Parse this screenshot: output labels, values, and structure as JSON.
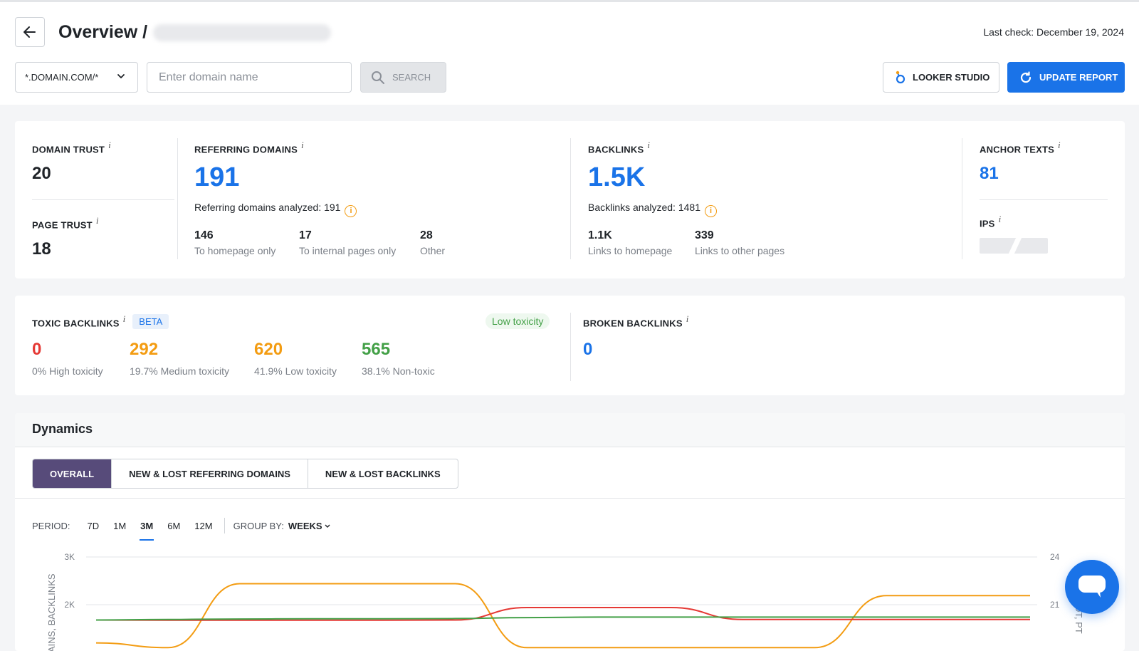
{
  "header": {
    "title": "Overview /",
    "last_check": "Last check: December 19, 2024",
    "scope_value": "*.DOMAIN.COM/*",
    "domain_placeholder": "Enter domain name",
    "search_label": "SEARCH",
    "looker_label": "LOOKER STUDIO",
    "update_label": "UPDATE REPORT"
  },
  "metrics": {
    "domain_trust": {
      "label": "DOMAIN TRUST",
      "value": "20"
    },
    "page_trust": {
      "label": "PAGE TRUST",
      "value": "18"
    },
    "referring_domains": {
      "label": "REFERRING DOMAINS",
      "value": "191",
      "analyzed": "Referring domains analyzed: 191",
      "breakdown": [
        {
          "value": "146",
          "caption": "To homepage only"
        },
        {
          "value": "17",
          "caption": "To internal pages only"
        },
        {
          "value": "28",
          "caption": "Other"
        }
      ]
    },
    "backlinks": {
      "label": "BACKLINKS",
      "value": "1.5K",
      "analyzed": "Backlinks analyzed: 1481",
      "breakdown": [
        {
          "value": "1.1K",
          "caption": "Links to homepage"
        },
        {
          "value": "339",
          "caption": "Links to other pages"
        }
      ]
    },
    "anchor_texts": {
      "label": "ANCHOR TEXTS",
      "value": "81"
    },
    "ips": {
      "label": "IPS"
    }
  },
  "toxic": {
    "label": "TOXIC BACKLINKS",
    "beta": "BETA",
    "badge": "Low toxicity",
    "items": [
      {
        "value": "0",
        "caption": "0% High toxicity",
        "color": "#e53935"
      },
      {
        "value": "292",
        "caption": "19.7% Medium toxicity",
        "color": "#f39c12"
      },
      {
        "value": "620",
        "caption": "41.9% Low toxicity",
        "color": "#f39c12"
      },
      {
        "value": "565",
        "caption": "38.1% Non-toxic",
        "color": "#43a047"
      }
    ]
  },
  "broken": {
    "label": "BROKEN BACKLINKS",
    "value": "0"
  },
  "dynamics": {
    "title": "Dynamics",
    "tabs": [
      "OVERALL",
      "NEW & LOST REFERRING DOMAINS",
      "NEW & LOST BACKLINKS"
    ],
    "period_label": "PERIOD:",
    "periods": [
      "7D",
      "1M",
      "3M",
      "6M",
      "12M"
    ],
    "active_period": "3M",
    "group_label": "GROUP BY:",
    "group_value": "WEEKS"
  },
  "chart_data": {
    "type": "line",
    "y_left": {
      "label": "AINS, BACKLINKS",
      "ticks": [
        "3K",
        "2K"
      ],
      "range": [
        1000,
        3000
      ]
    },
    "y_right": {
      "label": "DT, PT",
      "ticks": [
        "24",
        "21"
      ]
    },
    "x_index": [
      0,
      1,
      2,
      3,
      4,
      5,
      6,
      7,
      8,
      9,
      10,
      11,
      12,
      13
    ],
    "series": [
      {
        "color": "#f39c12",
        "values": [
          1200,
          1100,
          2440,
          2440,
          2440,
          2440,
          1100,
          1100,
          1100,
          1100,
          1100,
          2190,
          2190,
          2190
        ]
      },
      {
        "color": "#e53935",
        "values": [
          1680,
          1675,
          1675,
          1675,
          1675,
          1680,
          1940,
          1940,
          1940,
          1690,
          1690,
          1690,
          1690,
          1690
        ]
      },
      {
        "color": "#43a047",
        "values": [
          1680,
          1690,
          1700,
          1705,
          1705,
          1710,
          1730,
          1740,
          1740,
          1740,
          1740,
          1740,
          1740,
          1740
        ]
      }
    ]
  }
}
